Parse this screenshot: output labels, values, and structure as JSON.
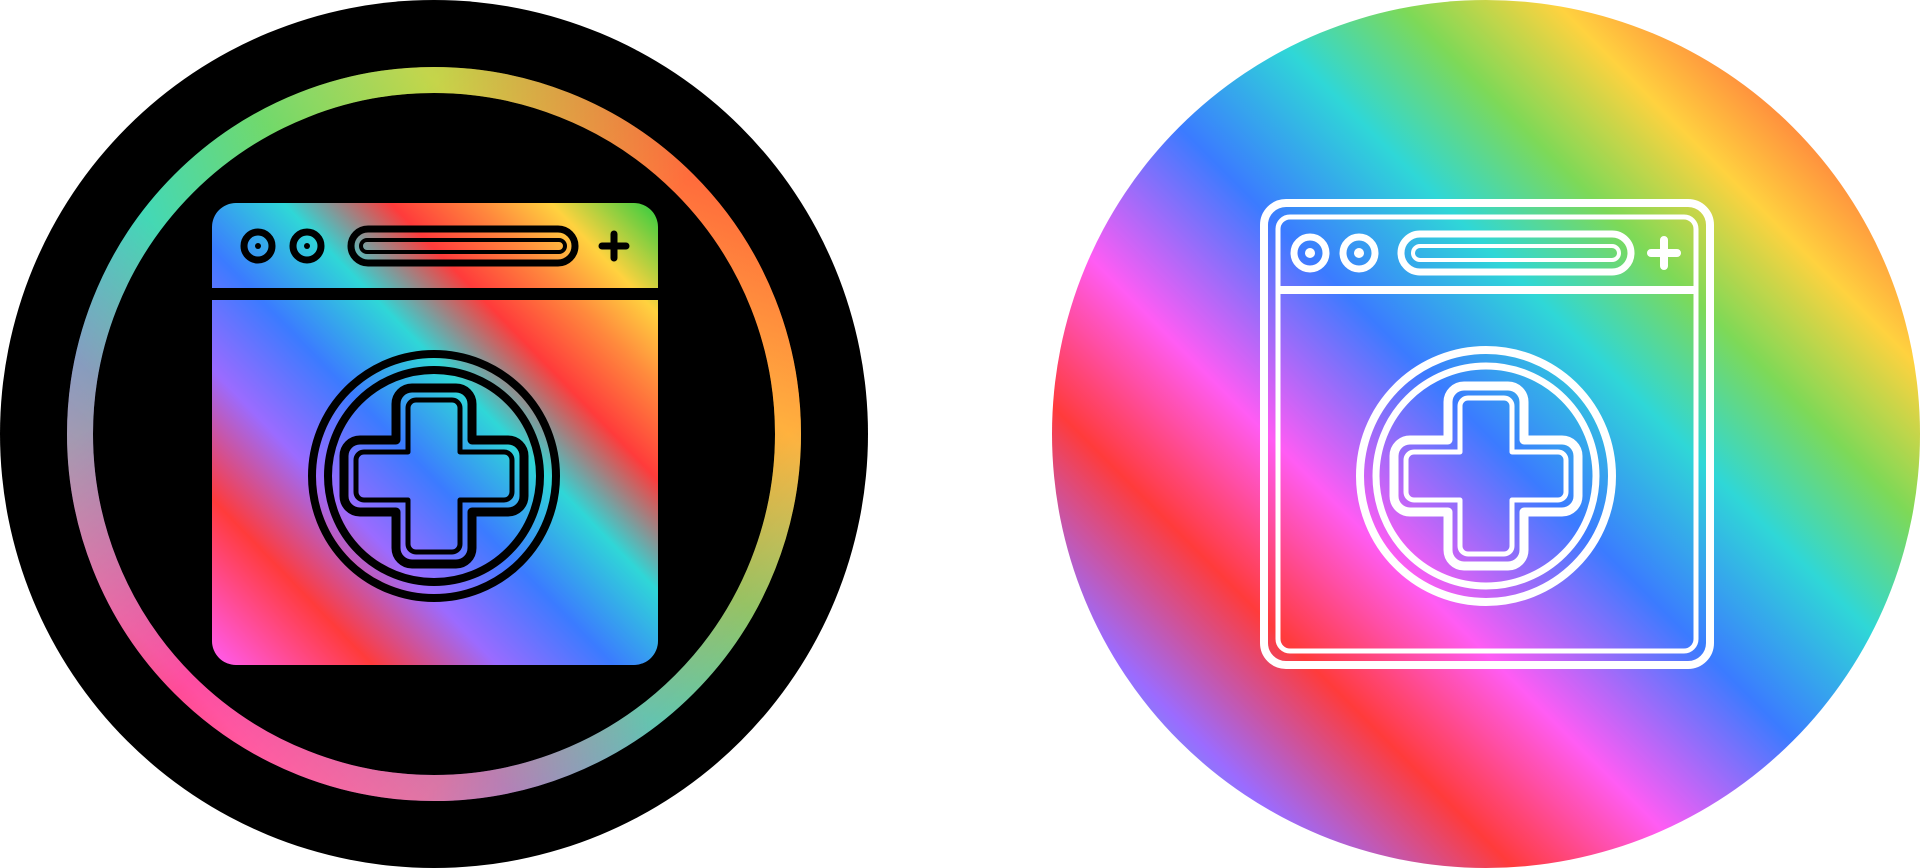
{
  "icons": [
    {
      "name": "medical-website",
      "variant": "gradient-fill-on-black-circle"
    },
    {
      "name": "medical-website",
      "variant": "white-outline-on-gradient-circle"
    }
  ],
  "colors": {
    "black": "#000000",
    "white": "#ffffff",
    "gradient_stops": [
      "#ff5cf4",
      "#ff3b3b",
      "#ff8a3d",
      "#ffd23f",
      "#7ed957",
      "#2fd7d7",
      "#3b7bff",
      "#9b6bff",
      "#ff5cf4"
    ]
  }
}
